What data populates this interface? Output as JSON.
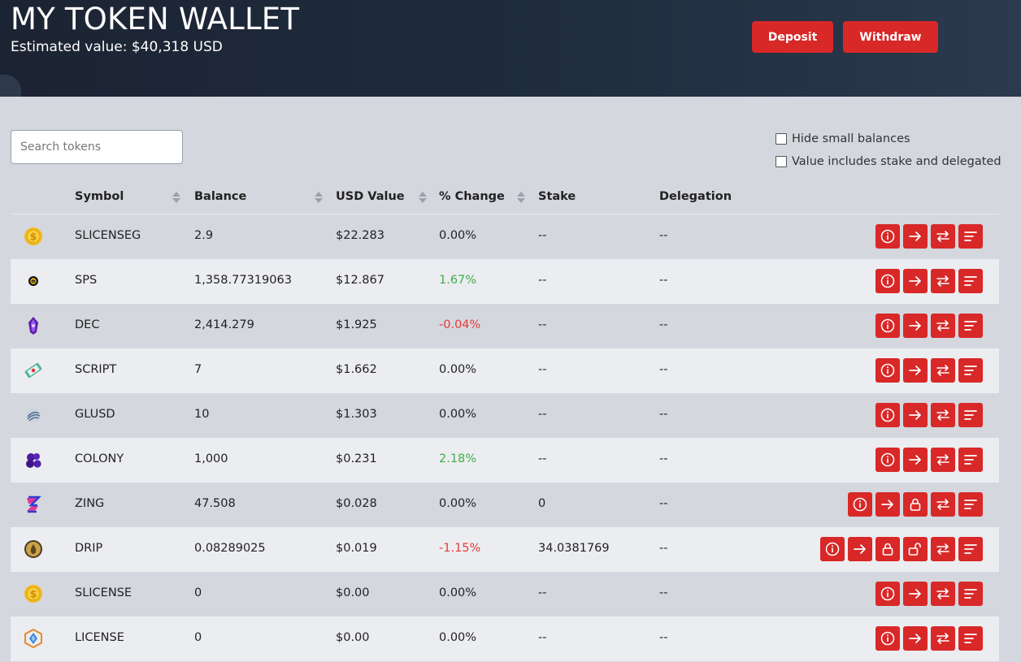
{
  "header": {
    "title": "MY TOKEN WALLET",
    "estimated_value": "Estimated value: $40,318 USD",
    "deposit_label": "Deposit",
    "withdraw_label": "Withdraw"
  },
  "search": {
    "placeholder": "Search tokens",
    "value": ""
  },
  "filters": {
    "hide_small_label": "Hide small balances",
    "hide_small_checked": false,
    "include_stake_label": "Value includes stake and delegated",
    "include_stake_checked": false
  },
  "table": {
    "columns": {
      "symbol": "Symbol",
      "balance": "Balance",
      "usd_value": "USD Value",
      "change": "% Change",
      "stake": "Stake",
      "delegation": "Delegation"
    },
    "rows": [
      {
        "icon": "slicenseg-coin-icon",
        "symbol": "SLICENSEG",
        "balance": "2.9",
        "usd": "$22.283",
        "change": "0.00%",
        "trend": "flat",
        "stake": "--",
        "delegation": "--",
        "actions": [
          "info",
          "transfer",
          "swap",
          "history"
        ]
      },
      {
        "icon": "sps-coin-icon",
        "symbol": "SPS",
        "balance": "1,358.77319063",
        "usd": "$12.867",
        "change": "1.67%",
        "trend": "up",
        "stake": "--",
        "delegation": "--",
        "actions": [
          "info",
          "transfer",
          "swap",
          "history"
        ]
      },
      {
        "icon": "dec-crystal-icon",
        "symbol": "DEC",
        "balance": "2,414.279",
        "usd": "$1.925",
        "change": "-0.04%",
        "trend": "down",
        "stake": "--",
        "delegation": "--",
        "actions": [
          "info",
          "transfer",
          "swap",
          "history"
        ]
      },
      {
        "icon": "script-scroll-icon",
        "symbol": "SCRIPT",
        "balance": "7",
        "usd": "$1.662",
        "change": "0.00%",
        "trend": "flat",
        "stake": "--",
        "delegation": "--",
        "actions": [
          "info",
          "transfer",
          "swap",
          "history"
        ]
      },
      {
        "icon": "glusd-globe-icon",
        "symbol": "GLUSD",
        "balance": "10",
        "usd": "$1.303",
        "change": "0.00%",
        "trend": "flat",
        "stake": "--",
        "delegation": "--",
        "actions": [
          "info",
          "transfer",
          "swap",
          "history"
        ]
      },
      {
        "icon": "colony-cluster-icon",
        "symbol": "COLONY",
        "balance": "1,000",
        "usd": "$0.231",
        "change": "2.18%",
        "trend": "up",
        "stake": "--",
        "delegation": "--",
        "actions": [
          "info",
          "transfer",
          "swap",
          "history"
        ]
      },
      {
        "icon": "zing-z-icon",
        "symbol": "ZING",
        "balance": "47.508",
        "usd": "$0.028",
        "change": "0.00%",
        "trend": "flat",
        "stake": "0",
        "delegation": "--",
        "actions": [
          "info",
          "transfer",
          "lock",
          "swap",
          "history"
        ]
      },
      {
        "icon": "drip-drop-icon",
        "symbol": "DRIP",
        "balance": "0.08289025",
        "usd": "$0.019",
        "change": "-1.15%",
        "trend": "down",
        "stake": "34.0381769",
        "delegation": "--",
        "actions": [
          "info",
          "transfer",
          "lock",
          "unlock",
          "swap",
          "history"
        ]
      },
      {
        "icon": "slicense-coin-icon",
        "symbol": "SLICENSE",
        "balance": "0",
        "usd": "$0.00",
        "change": "0.00%",
        "trend": "flat",
        "stake": "--",
        "delegation": "--",
        "actions": [
          "info",
          "transfer",
          "swap",
          "history"
        ]
      },
      {
        "icon": "license-hex-icon",
        "symbol": "LICENSE",
        "balance": "0",
        "usd": "$0.00",
        "change": "0.00%",
        "trend": "flat",
        "stake": "--",
        "delegation": "--",
        "actions": [
          "info",
          "transfer",
          "swap",
          "history"
        ]
      }
    ]
  },
  "colors": {
    "accent_red": "#d82828",
    "positive": "#3fae4a",
    "negative": "#e23b3b",
    "header_bg": "#1e2a3b",
    "page_bg": "#d5d7de"
  }
}
